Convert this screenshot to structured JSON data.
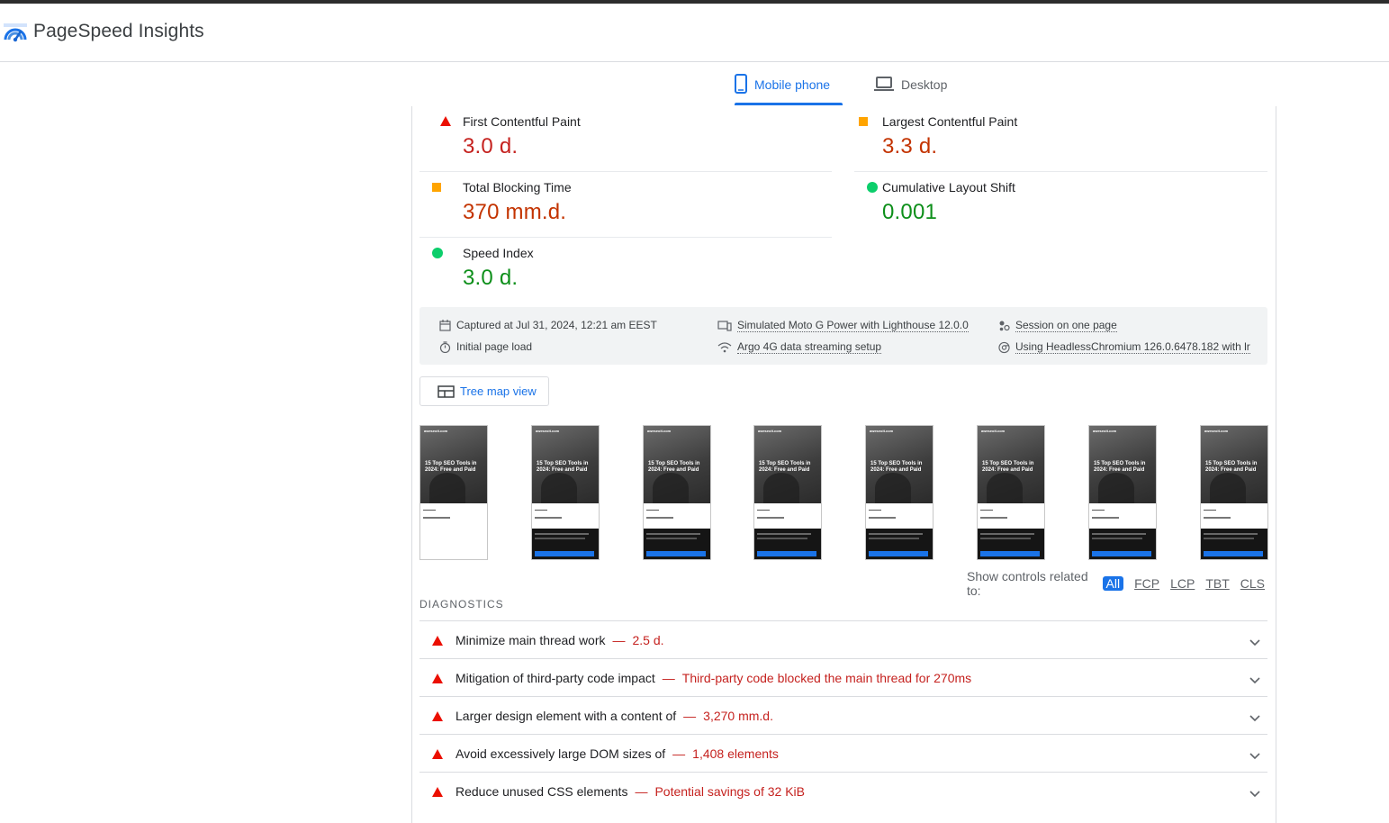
{
  "app": {
    "name": "PageSpeed Insights"
  },
  "tabs": [
    {
      "label": "Mobile phone",
      "icon": "smartphone-icon",
      "active": true
    },
    {
      "label": "Desktop",
      "icon": "laptop-icon",
      "active": false
    }
  ],
  "metrics": [
    {
      "name": "First Contentful Paint",
      "value": "3.0 d.",
      "status": "fail"
    },
    {
      "name": "Largest Contentful Paint",
      "value": "3.3 d.",
      "status": "average"
    },
    {
      "name": "Total Blocking Time",
      "value": "370 mm.d.",
      "status": "average"
    },
    {
      "name": "Cumulative Layout Shift",
      "value": "0.001",
      "status": "pass"
    },
    {
      "name": "Speed Index",
      "value": "3.0 d.",
      "status": "pass"
    }
  ],
  "environment": {
    "captured": "Captured at Jul 31, 2024, 12:21 am EEST",
    "load": "Initial page load",
    "device": "Simulated Moto G Power with Lighthouse 12.0.0",
    "network": "Argo 4G data streaming setup",
    "session": "Session on one page",
    "browser": "Using HeadlessChromium 126.0.6478.182 with lr"
  },
  "treemap": {
    "label": "Tree map view"
  },
  "filmstrip": {
    "site": "aweseoit.com",
    "headline": "15 Top SEO Tools in 2024: Free and Paid",
    "frames": 8
  },
  "controls": {
    "label": "Show controls related to:",
    "options": [
      "All",
      "FCP",
      "LCP",
      "TBT",
      "CLS"
    ],
    "active": "All"
  },
  "diagnostics": {
    "title": "DIAGNOSTICS",
    "items": [
      {
        "title": "Minimize main thread work",
        "separator": "—",
        "value": "2.5 d."
      },
      {
        "title": "Mitigation of third-party code impact",
        "separator": "—",
        "value": "Third-party code blocked the main thread for 270ms"
      },
      {
        "title": "Larger design element with a content of",
        "separator": "—",
        "value": "3,270 mm.d."
      },
      {
        "title": "Avoid excessively large DOM sizes of",
        "separator": "—",
        "value": "1,408 elements"
      },
      {
        "title": "Reduce unused CSS elements",
        "separator": "—",
        "value": "Potential savings of 32 KiB"
      }
    ]
  },
  "colors": {
    "accent": "#1a73e8",
    "fail": "#eb0f00",
    "average": "#ffa400",
    "pass": "#0cce6b"
  }
}
